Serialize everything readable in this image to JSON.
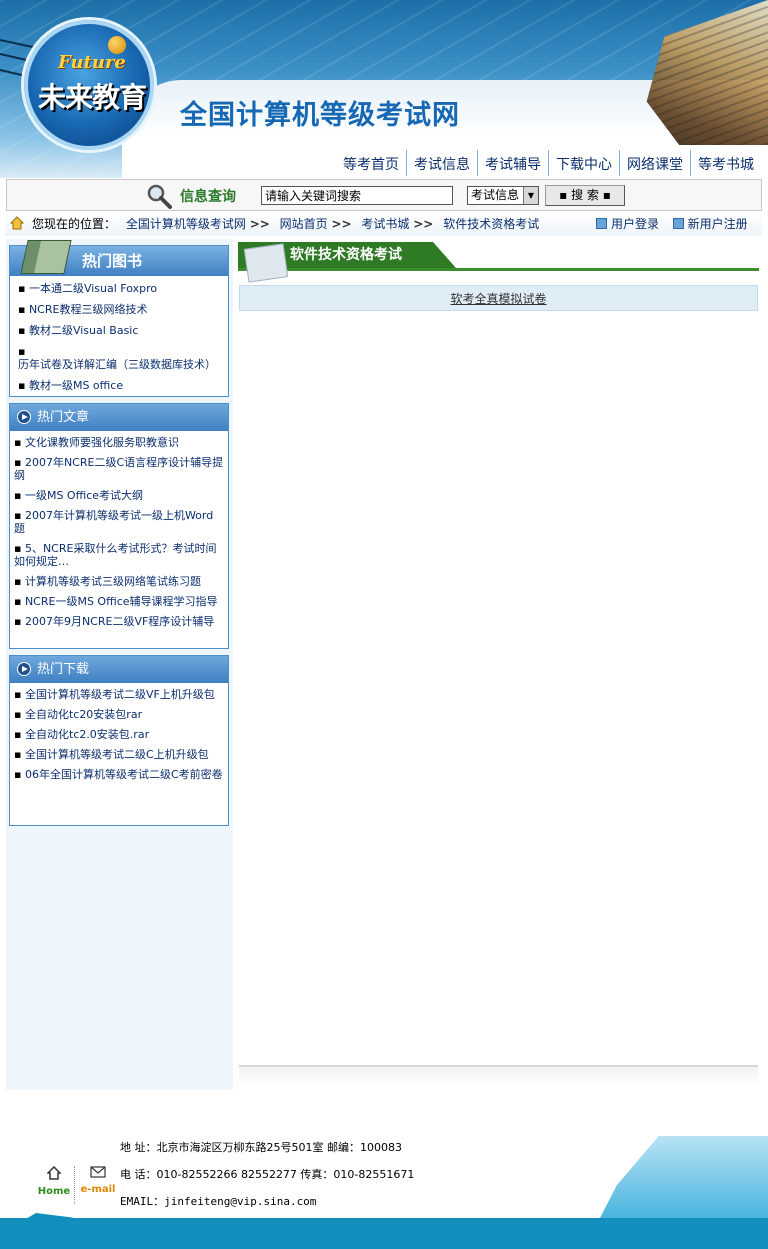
{
  "header": {
    "logo_en": "Future",
    "logo_cn": "未来教育",
    "site_title": "全国计算机等级考试网"
  },
  "nav": {
    "items": [
      "等考首页",
      "考试信息",
      "考试辅导",
      "下载中心",
      "网络课堂",
      "等考书城"
    ]
  },
  "search": {
    "label": "信息查询",
    "input_value": "请输入关键词搜索",
    "select_value": "考试信息",
    "button_label": "▪ 搜 索 ▪"
  },
  "breadcrumb": {
    "prefix": "您现在的位置：",
    "separator": ">>",
    "items": [
      "全国计算机等级考试网",
      "网站首页",
      "考试书城",
      "软件技术资格考试"
    ],
    "login": "用户登录",
    "register": "新用户注册"
  },
  "sidebar": {
    "books": {
      "title": "热门图书",
      "items": [
        "一本通二级Visual Foxpro",
        "NCRE教程三级网络技术",
        "教材二级Visual Basic",
        "历年试卷及详解汇编（三级数据库技术）",
        "教材一级MS office"
      ]
    },
    "articles": {
      "title": "热门文章",
      "items": [
        "文化课教师要强化服务职教意识",
        "2007年NCRE二级C语言程序设计辅导提纲",
        "一级MS Office考试大纲",
        "2007年计算机等级考试一级上机Word题",
        "5、NCRE采取什么考试形式？考试时间如何规定…",
        "计算机等级考试三级网络笔试练习题",
        "NCRE一级MS Office辅导课程学习指导",
        "2007年9月NCRE二级VF程序设计辅导"
      ]
    },
    "downloads": {
      "title": "热门下载",
      "items": [
        "全国计算机等级考试二级VF上机升级包",
        "全自动化tc20安装包rar",
        "全自动化tc2.0安装包.rar",
        "全国计算机等级考试二级C上机升级包",
        "06年全国计算机等级考试二级C考前密卷"
      ]
    }
  },
  "main": {
    "title": "软件技术资格考试",
    "items": [
      "软考全真模拟试卷"
    ]
  },
  "footer": {
    "address": "地 址：北京市海淀区万柳东路25号501室  邮编：100083",
    "phone": "电 话：010-82552266 82552277 传真：010-82551671",
    "email": "EMAIL：jinfeiteng@vip.sina.com",
    "home_label": "Home",
    "email_label": "e-mail"
  },
  "colors": {
    "nav_link": "#0b2f6e",
    "sidebar_header": "#3f7fc2",
    "main_title_bg": "#2f7a25",
    "footer_band": "#138fbd"
  }
}
